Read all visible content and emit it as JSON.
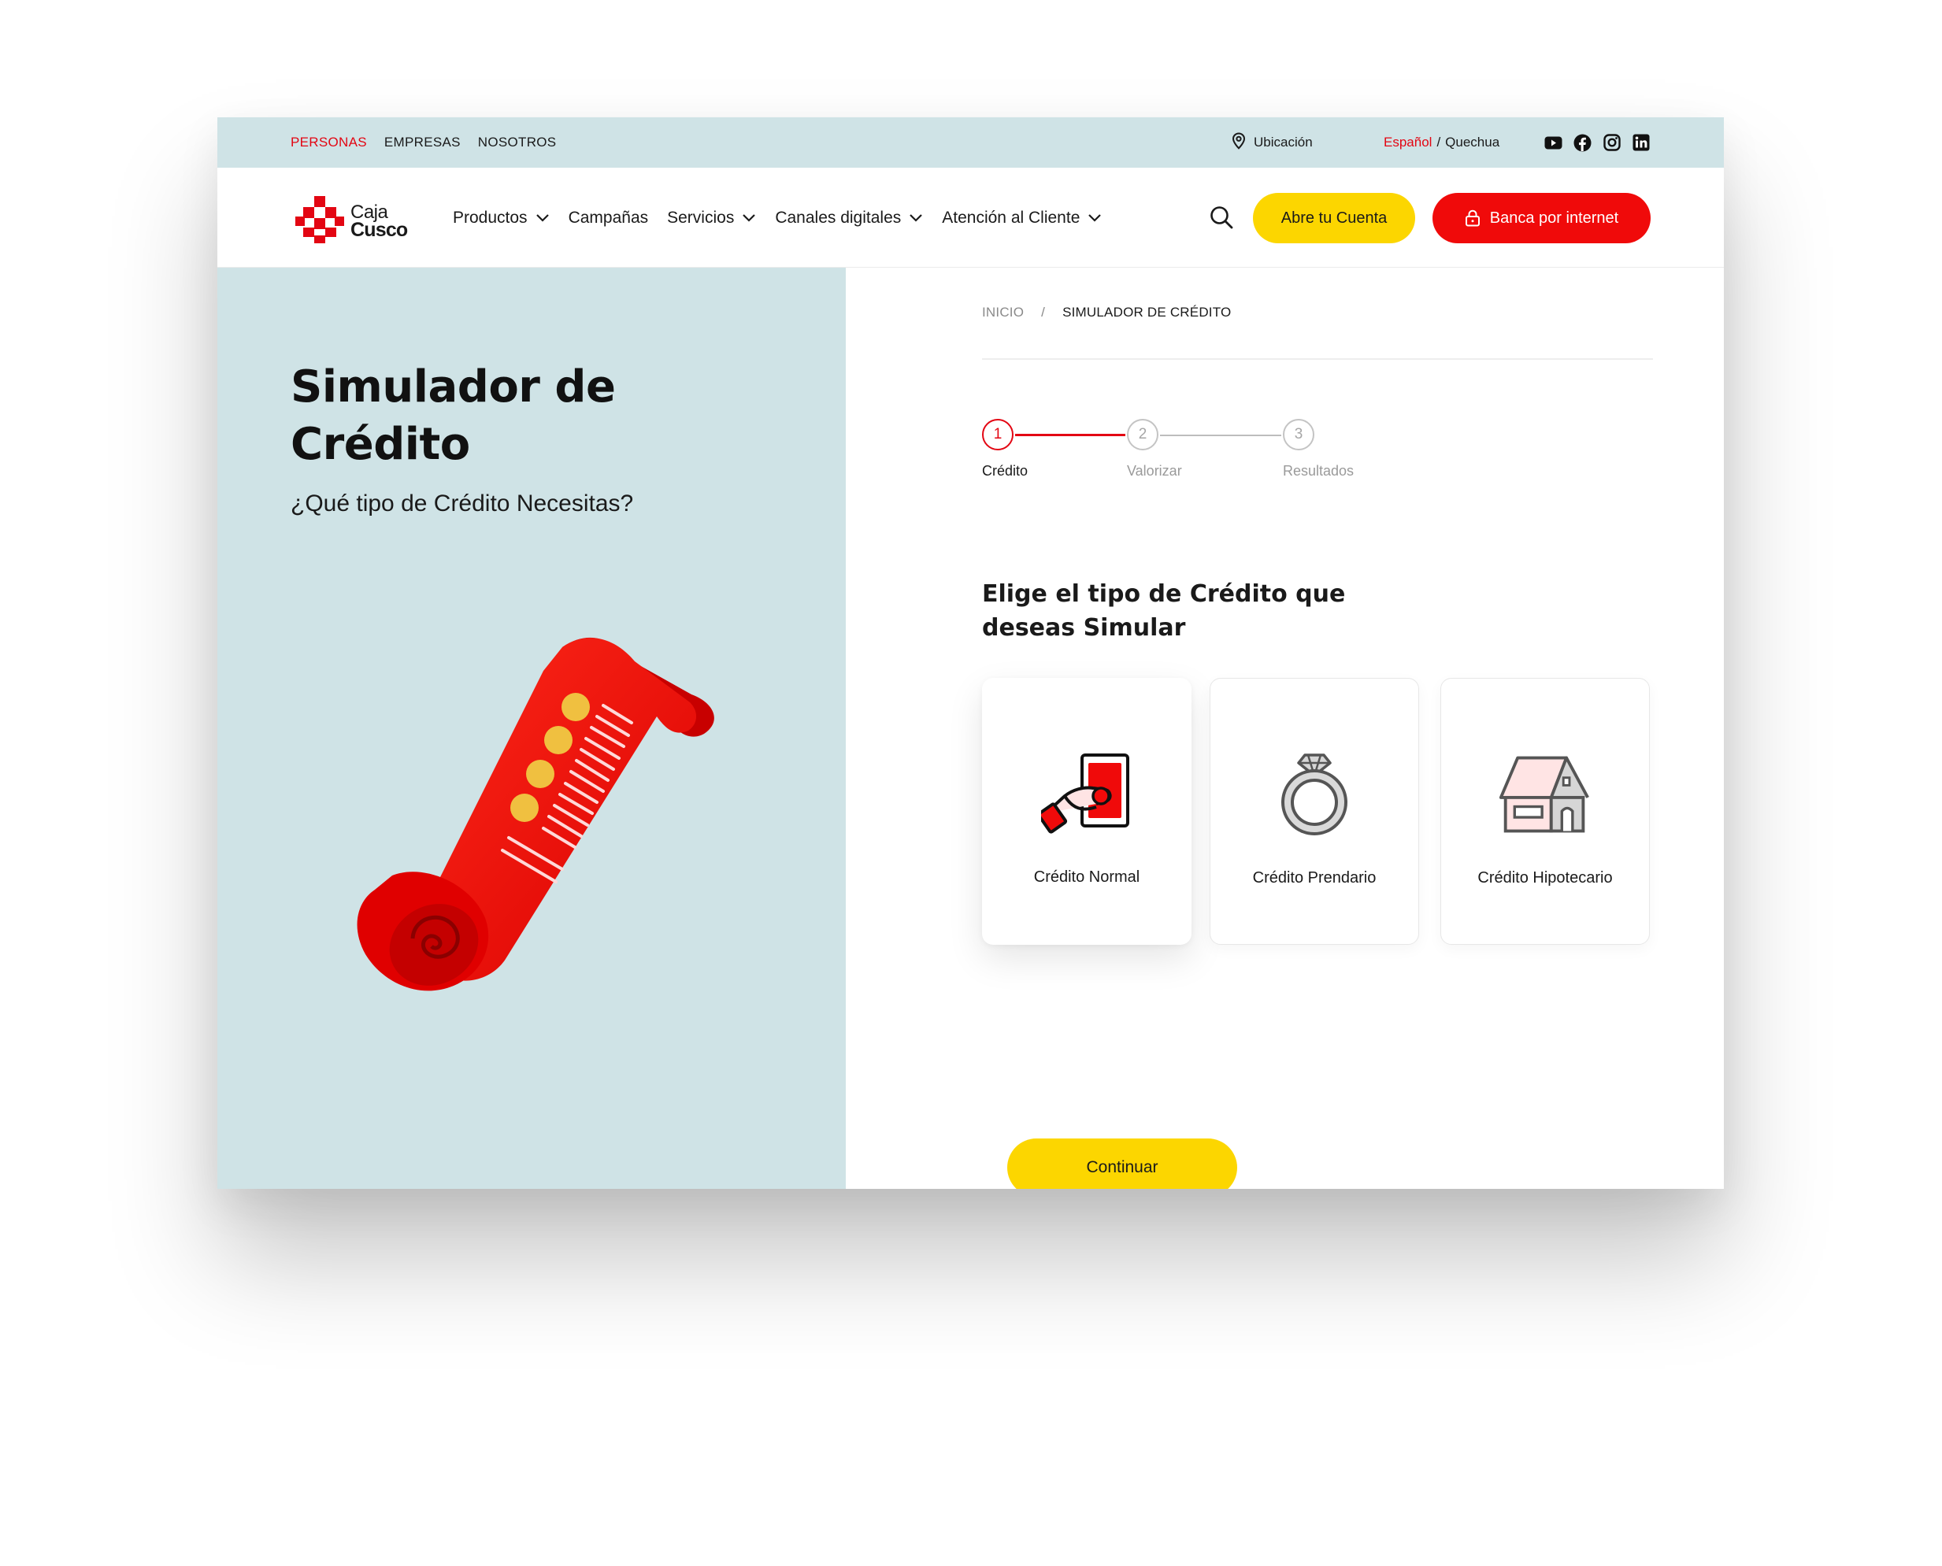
{
  "topbar": {
    "segments": [
      "PERSONAS",
      "EMPRESAS",
      "NOSOTROS"
    ],
    "active_segment": "PERSONAS",
    "location_label": "Ubicación",
    "language_active": "Español",
    "language_separator": "/",
    "language_other": "Quechua",
    "social_icons": [
      "youtube-icon",
      "facebook-icon",
      "instagram-icon",
      "linkedin-icon"
    ]
  },
  "header": {
    "logo_line1": "Caja",
    "logo_line2": "Cusco",
    "nav": [
      {
        "label": "Productos",
        "dropdown": true
      },
      {
        "label": "Campañas",
        "dropdown": false
      },
      {
        "label": "Servicios",
        "dropdown": true
      },
      {
        "label": "Canales digitales",
        "dropdown": true
      },
      {
        "label": "Atención al Cliente",
        "dropdown": true
      }
    ],
    "cta_account": "Abre tu Cuenta",
    "cta_banking": "Banca por internet"
  },
  "hero": {
    "title": "Simulador de Crédito",
    "subtitle": "¿Qué tipo de Crédito Necesitas?"
  },
  "breadcrumb": {
    "home": "INICIO",
    "separator": "/",
    "current": "SIMULADOR DE CRÉDITO"
  },
  "stepper": {
    "steps": [
      {
        "number": "1",
        "label": "Crédito"
      },
      {
        "number": "2",
        "label": "Valorizar"
      },
      {
        "number": "3",
        "label": "Resultados"
      }
    ],
    "current_step": 1
  },
  "question": "Elige el tipo de Crédito que deseas Simular",
  "options": [
    {
      "label": "Crédito Normal",
      "icon": "hand-card-icon",
      "selected": true
    },
    {
      "label": "Crédito Prendario",
      "icon": "ring-icon",
      "selected": false
    },
    {
      "label": "Crédito Hipotecario",
      "icon": "house-icon",
      "selected": false
    }
  ],
  "continue_label": "Continuar",
  "colors": {
    "brand_red": "#e30613",
    "brand_yellow": "#fcd600",
    "panel_blue": "#cfe3e6"
  }
}
